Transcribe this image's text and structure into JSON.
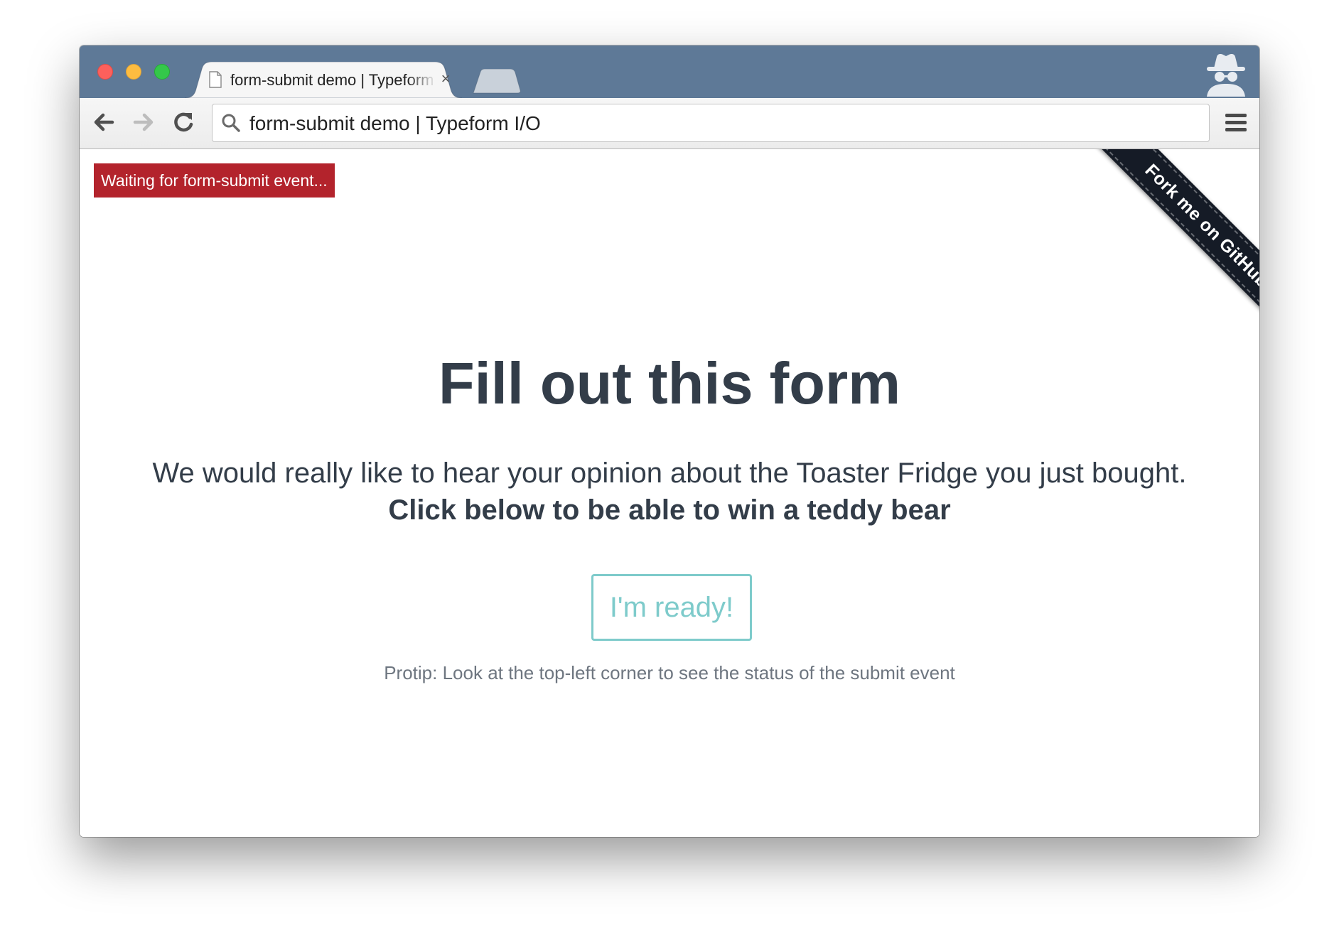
{
  "browser": {
    "tab_title": "form-submit demo | Typeform I/O",
    "tab_close_glyph": "×",
    "address_bar_text": "form-submit demo | Typeform I/O",
    "icons": {
      "back": "arrow-left-icon",
      "forward": "arrow-right-icon",
      "reload": "reload-icon",
      "search": "search-icon",
      "menu": "hamburger-menu-icon",
      "incognito": "incognito-icon",
      "page": "page-icon"
    }
  },
  "page": {
    "status_badge": "Waiting for form-submit event...",
    "ribbon": "Fork me on GitHub",
    "headline": "Fill out this form",
    "intro_line": "We would really like to hear your opinion about the Toaster Fridge you just bought.",
    "intro_bold": "Click below to be able to win a teddy bear",
    "cta_label": "I'm ready!",
    "protip": "Protip: Look at the top-left corner to see the status of the submit event"
  },
  "colors": {
    "titlebar": "#5e7997",
    "status_badge_bg": "#b3232c",
    "ribbon_bg": "#151b26",
    "heading_text": "#333d49",
    "cta_accent": "#7ecbcb",
    "protip_text": "#6e7680"
  }
}
